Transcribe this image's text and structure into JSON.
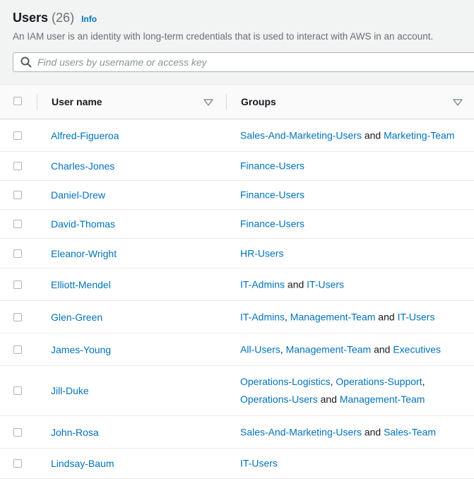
{
  "header": {
    "title": "Users",
    "count": "(26)",
    "info": "Info",
    "description": "An IAM user is an identity with long-term credentials that is used to interact with AWS in an account."
  },
  "search": {
    "placeholder": "Find users by username or access key"
  },
  "columns": {
    "user_name": "User name",
    "groups": "Groups"
  },
  "rows": [
    {
      "user": "Alfred-Figueroa",
      "groups": [
        [
          "Sales-And-Marketing-Users",
          " and "
        ],
        [
          "Marketing-Team",
          ""
        ]
      ]
    },
    {
      "user": "Charles-Jones",
      "groups": [
        [
          "Finance-Users",
          ""
        ]
      ]
    },
    {
      "user": "Daniel-Drew",
      "groups": [
        [
          "Finance-Users",
          ""
        ]
      ]
    },
    {
      "user": "David-Thomas",
      "groups": [
        [
          "Finance-Users",
          ""
        ]
      ]
    },
    {
      "user": "Eleanor-Wright",
      "groups": [
        [
          "HR-Users",
          ""
        ]
      ]
    },
    {
      "user": "Elliott-Mendel",
      "groups": [
        [
          "IT-Admins",
          " and "
        ],
        [
          "IT-Users",
          ""
        ]
      ]
    },
    {
      "user": "Glen-Green",
      "groups": [
        [
          "IT-Admins",
          ", "
        ],
        [
          "Management-Team",
          " and "
        ],
        [
          "IT-Users",
          ""
        ]
      ]
    },
    {
      "user": "James-Young",
      "groups": [
        [
          "All-Users",
          ", "
        ],
        [
          "Management-Team",
          " and "
        ],
        [
          "Executives",
          ""
        ]
      ]
    },
    {
      "user": "Jill-Duke",
      "groups": [
        [
          "Operations-Logistics",
          ", "
        ],
        [
          "Operations-Support",
          ","
        ],
        [
          "Operations-Users",
          " and "
        ],
        [
          "Management-Team",
          ""
        ]
      ]
    },
    {
      "user": "John-Rosa",
      "groups": [
        [
          "Sales-And-Marketing-Users",
          " and "
        ],
        [
          "Sales-Team",
          ""
        ]
      ]
    },
    {
      "user": "Lindsay-Baum",
      "groups": [
        [
          "IT-Users",
          ""
        ]
      ]
    }
  ]
}
